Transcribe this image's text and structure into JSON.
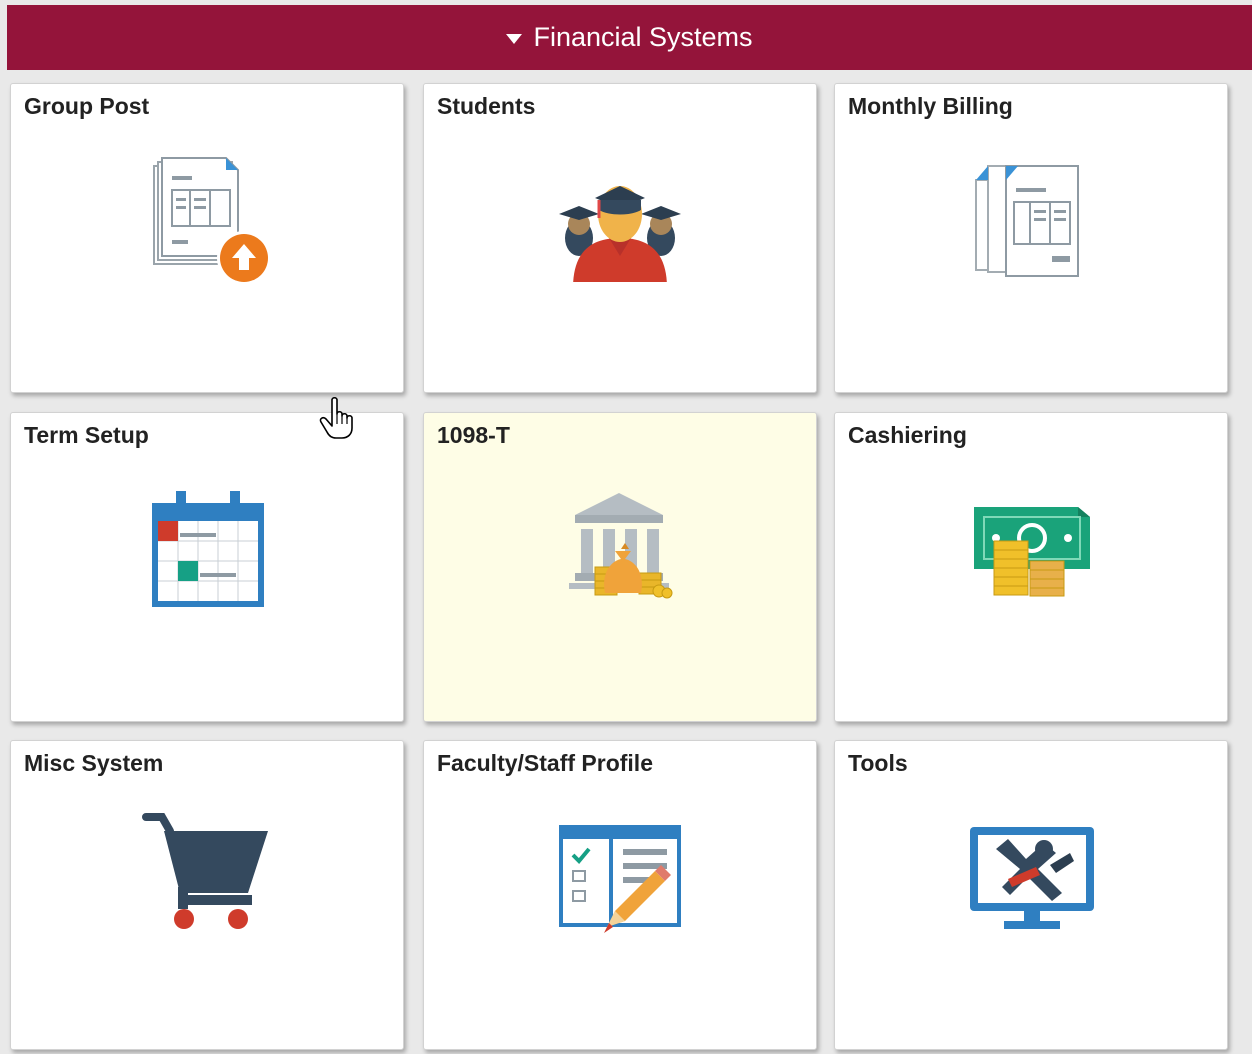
{
  "header": {
    "title": "Financial Systems",
    "background_color": "#94143a"
  },
  "tiles": [
    {
      "title": "Group Post",
      "icon": "document-upload-icon"
    },
    {
      "title": "Students",
      "icon": "graduates-icon"
    },
    {
      "title": "Monthly Billing",
      "icon": "billing-documents-icon"
    },
    {
      "title": "Term Setup",
      "icon": "calendar-icon"
    },
    {
      "title": "1098-T",
      "icon": "bank-money-icon",
      "highlighted": true
    },
    {
      "title": "Cashiering",
      "icon": "cash-coins-icon"
    },
    {
      "title": "Misc System",
      "icon": "shopping-cart-icon"
    },
    {
      "title": "Faculty/Staff Profile",
      "icon": "checklist-pencil-icon"
    },
    {
      "title": "Tools",
      "icon": "monitor-tools-icon"
    }
  ]
}
